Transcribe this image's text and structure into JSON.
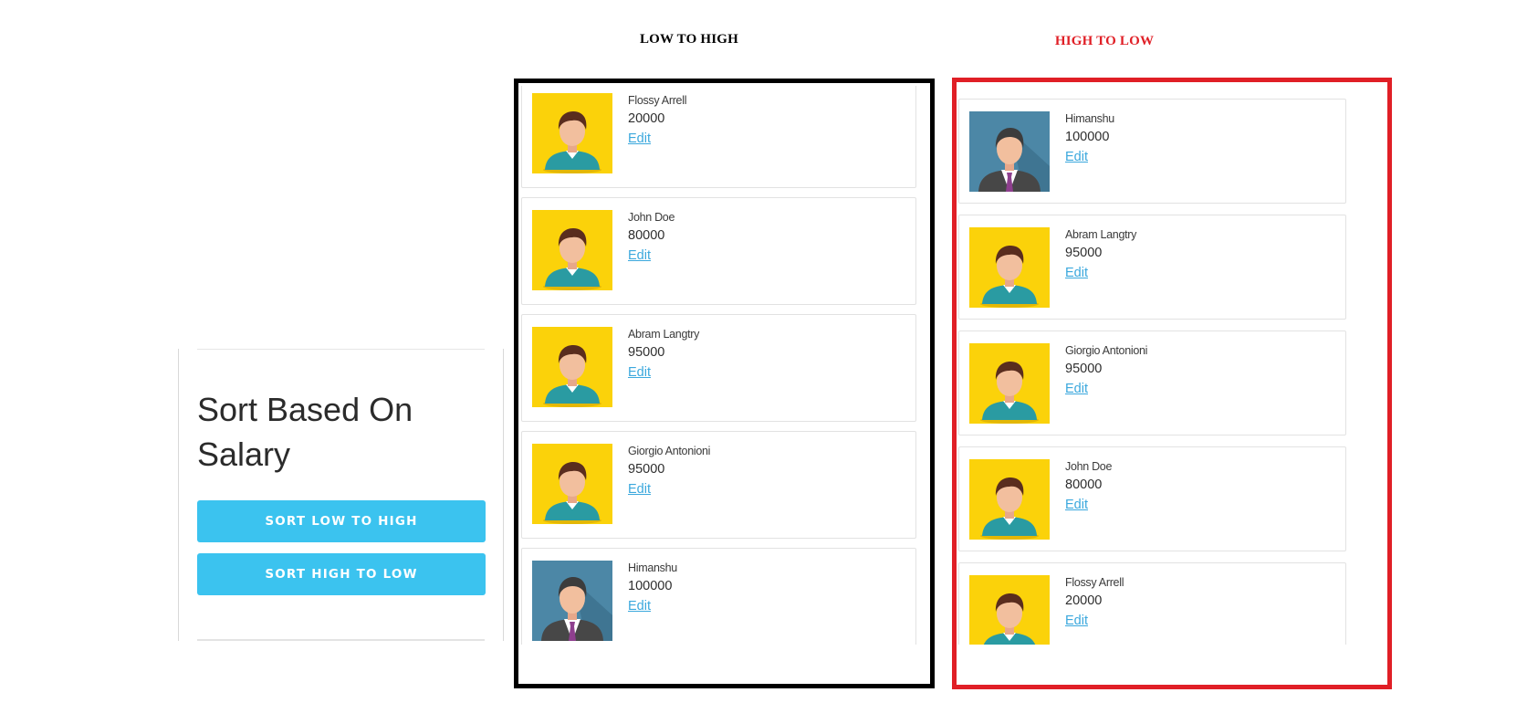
{
  "headings": {
    "low_to_high": "LOW TO HIGH",
    "high_to_low": "HIGH TO LOW"
  },
  "panel": {
    "title": "Sort Based On Salary",
    "sort_low_label": "SORT LOW TO HIGH",
    "sort_high_label": "SORT HIGH TO LOW"
  },
  "colors": {
    "button": "#3bc3ef",
    "low_frame": "#000000",
    "high_frame": "#e01f26",
    "link": "#3ba8dd"
  },
  "low_to_high_list": [
    {
      "name": "Flossy Arrell",
      "salary": "20000",
      "edit_label": "Edit",
      "avatar": "casual-person-avatar-icon"
    },
    {
      "name": "John Doe",
      "salary": "80000",
      "edit_label": "Edit",
      "avatar": "casual-person-avatar-icon"
    },
    {
      "name": "Abram Langtry",
      "salary": "95000",
      "edit_label": "Edit",
      "avatar": "casual-person-avatar-icon"
    },
    {
      "name": "Giorgio Antonioni",
      "salary": "95000",
      "edit_label": "Edit",
      "avatar": "casual-person-avatar-icon"
    },
    {
      "name": "Himanshu",
      "salary": "100000",
      "edit_label": "Edit",
      "avatar": "businessman-avatar-icon"
    }
  ],
  "high_to_low_list": [
    {
      "name": "Himanshu",
      "salary": "100000",
      "edit_label": "Edit",
      "avatar": "businessman-avatar-icon"
    },
    {
      "name": "Abram Langtry",
      "salary": "95000",
      "edit_label": "Edit",
      "avatar": "casual-person-avatar-icon"
    },
    {
      "name": "Giorgio Antonioni",
      "salary": "95000",
      "edit_label": "Edit",
      "avatar": "casual-person-avatar-icon"
    },
    {
      "name": "John Doe",
      "salary": "80000",
      "edit_label": "Edit",
      "avatar": "casual-person-avatar-icon"
    },
    {
      "name": "Flossy Arrell",
      "salary": "20000",
      "edit_label": "Edit",
      "avatar": "casual-person-avatar-icon"
    }
  ]
}
